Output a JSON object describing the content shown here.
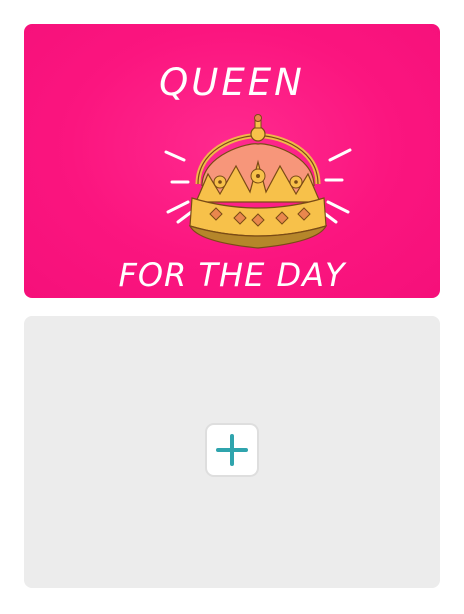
{
  "cards": [
    {
      "headline": "QUEEN",
      "subline": "FOR THE DAY",
      "background_color": "#fb157f",
      "illustration": "crown-icon"
    }
  ],
  "empty_card": {
    "action_icon": "plus-icon",
    "accent_color": "#2fa4ad"
  }
}
